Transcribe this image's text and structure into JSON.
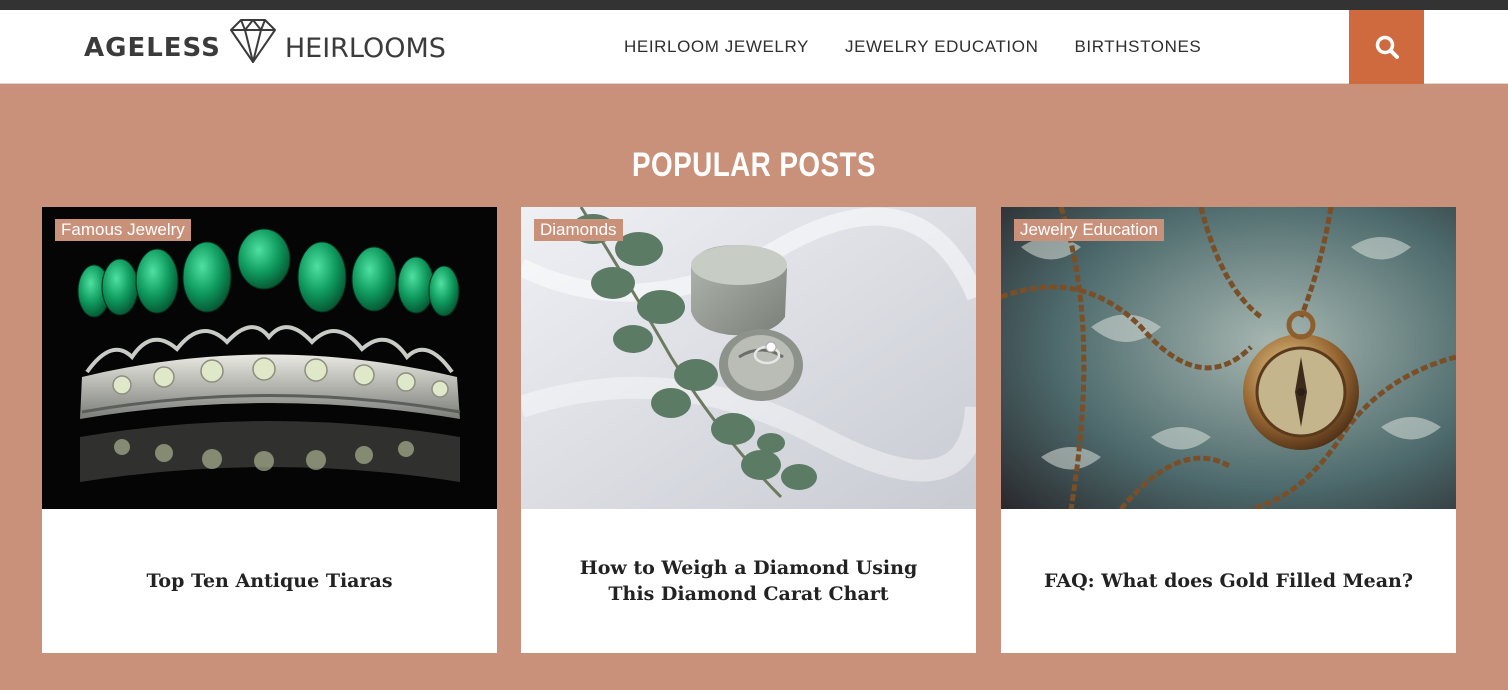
{
  "header": {
    "logo_text_bold": "AGELESS",
    "logo_text_light": "HEIRLOOMS",
    "nav": [
      {
        "label": "HEIRLOOM JEWELRY"
      },
      {
        "label": "JEWELRY EDUCATION"
      },
      {
        "label": "BIRTHSTONES"
      }
    ],
    "search_icon": "search-icon"
  },
  "colors": {
    "page_bg": "#c9917a",
    "accent": "#cf6a3e",
    "top_bar": "#333333"
  },
  "popular": {
    "title": "POPULAR POSTS",
    "posts": [
      {
        "category": "Famous Jewelry",
        "title": "Top Ten Antique Tiaras",
        "image": "emerald-tiara-image"
      },
      {
        "category": "Diamonds",
        "title": "How to Weigh a Diamond Using This Diamond Carat Chart",
        "image": "ring-box-image"
      },
      {
        "category": "Jewelry Education",
        "title": "FAQ: What does Gold Filled Mean?",
        "image": "compass-pendant-image"
      }
    ]
  }
}
